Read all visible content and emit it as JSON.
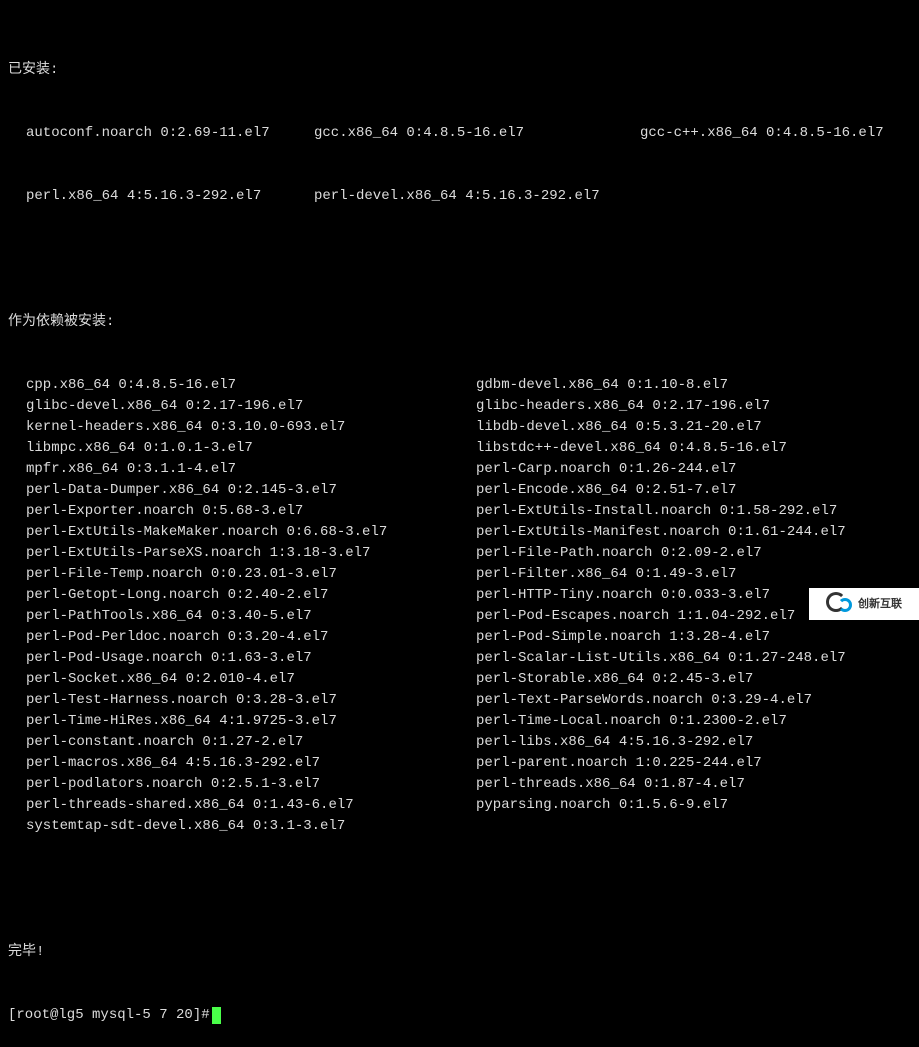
{
  "headers": {
    "installed": "已安装:",
    "deps_installed": "作为依赖被安装:",
    "complete": "完毕!",
    "prompt": "[root@lg5 mysql-5 7 20]#"
  },
  "installed": [
    [
      "autoconf.noarch 0:2.69-11.el7",
      "gcc.x86_64 0:4.8.5-16.el7",
      "gcc-c++.x86_64 0:4.8.5-16.el7"
    ],
    [
      "perl.x86_64 4:5.16.3-292.el7",
      "perl-devel.x86_64 4:5.16.3-292.el7",
      ""
    ]
  ],
  "deps_left": [
    "cpp.x86_64 0:4.8.5-16.el7",
    "glibc-devel.x86_64 0:2.17-196.el7",
    "kernel-headers.x86_64 0:3.10.0-693.el7",
    "libmpc.x86_64 0:1.0.1-3.el7",
    "mpfr.x86_64 0:3.1.1-4.el7",
    "perl-Data-Dumper.x86_64 0:2.145-3.el7",
    "perl-Exporter.noarch 0:5.68-3.el7",
    "perl-ExtUtils-MakeMaker.noarch 0:6.68-3.el7",
    "perl-ExtUtils-ParseXS.noarch 1:3.18-3.el7",
    "perl-File-Temp.noarch 0:0.23.01-3.el7",
    "perl-Getopt-Long.noarch 0:2.40-2.el7",
    "perl-PathTools.x86_64 0:3.40-5.el7",
    "perl-Pod-Perldoc.noarch 0:3.20-4.el7",
    "perl-Pod-Usage.noarch 0:1.63-3.el7",
    "perl-Socket.x86_64 0:2.010-4.el7",
    "perl-Test-Harness.noarch 0:3.28-3.el7",
    "perl-Time-HiRes.x86_64 4:1.9725-3.el7",
    "perl-constant.noarch 0:1.27-2.el7",
    "perl-macros.x86_64 4:5.16.3-292.el7",
    "perl-podlators.noarch 0:2.5.1-3.el7",
    "perl-threads-shared.x86_64 0:1.43-6.el7",
    "systemtap-sdt-devel.x86_64 0:3.1-3.el7"
  ],
  "deps_right": [
    "gdbm-devel.x86_64 0:1.10-8.el7",
    "glibc-headers.x86_64 0:2.17-196.el7",
    "libdb-devel.x86_64 0:5.3.21-20.el7",
    "libstdc++-devel.x86_64 0:4.8.5-16.el7",
    "perl-Carp.noarch 0:1.26-244.el7",
    "perl-Encode.x86_64 0:2.51-7.el7",
    "perl-ExtUtils-Install.noarch 0:1.58-292.el7",
    "perl-ExtUtils-Manifest.noarch 0:1.61-244.el7",
    "perl-File-Path.noarch 0:2.09-2.el7",
    "perl-Filter.x86_64 0:1.49-3.el7",
    "perl-HTTP-Tiny.noarch 0:0.033-3.el7",
    "perl-Pod-Escapes.noarch 1:1.04-292.el7",
    "perl-Pod-Simple.noarch 1:3.28-4.el7",
    "perl-Scalar-List-Utils.x86_64 0:1.27-248.el7",
    "perl-Storable.x86_64 0:2.45-3.el7",
    "perl-Text-ParseWords.noarch 0:3.29-4.el7",
    "perl-Time-Local.noarch 0:1.2300-2.el7",
    "perl-libs.x86_64 4:5.16.3-292.el7",
    "perl-parent.noarch 1:0.225-244.el7",
    "perl-threads.x86_64 0:1.87-4.el7",
    "pyparsing.noarch 0:1.5.6-9.el7"
  ],
  "watermark": "创新互联"
}
